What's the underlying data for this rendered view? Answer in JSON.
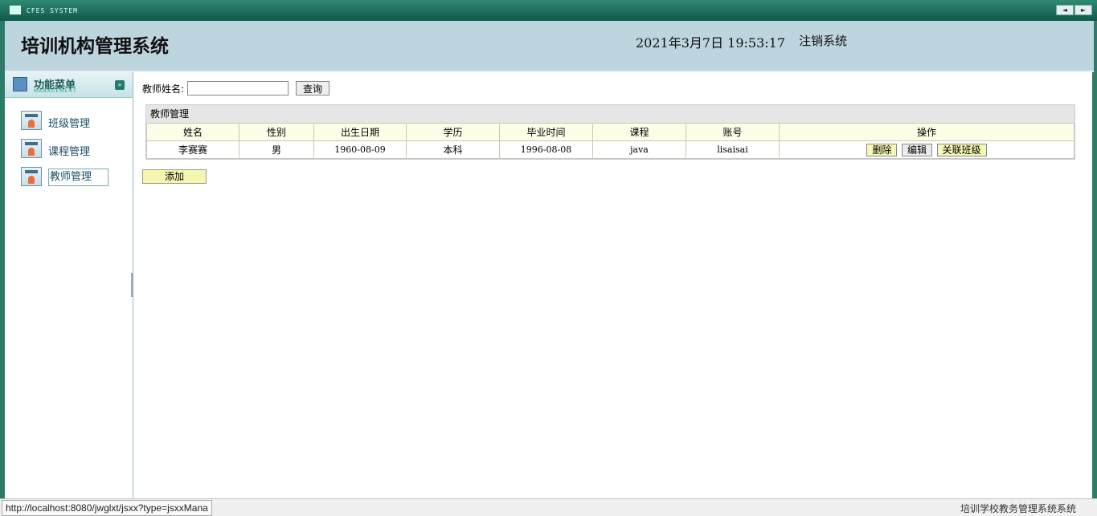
{
  "window": {
    "system_name": "CFES SYSTEM",
    "nav_prev": "◄",
    "nav_next": "►"
  },
  "header": {
    "title": "培训机构管理系统",
    "datetime": "2021年3月7日 19:53:17",
    "logout_label": "注销系统"
  },
  "sidebar": {
    "menu_title": "功能菜单",
    "menu_subtitle": "MANAGEMENT",
    "toggle_icon": "chevron-double-down-icon",
    "items": [
      {
        "label": "班级管理",
        "icon": "class-management-icon"
      },
      {
        "label": "课程管理",
        "icon": "course-management-icon"
      },
      {
        "label": "教师管理",
        "icon": "teacher-management-icon",
        "active": true
      }
    ]
  },
  "search": {
    "label": "教师姓名:",
    "value": "",
    "placeholder": "",
    "button_label": "查询"
  },
  "table": {
    "caption": "教师管理",
    "columns": [
      "姓名",
      "性别",
      "出生日期",
      "学历",
      "毕业时间",
      "课程",
      "账号",
      "操作"
    ],
    "rows": [
      {
        "name": "李赛赛",
        "gender": "男",
        "birth_date": "1960-08-09",
        "education": "本科",
        "graduation_date": "1996-08-08",
        "course": "java",
        "account": "lisaisai",
        "actions": {
          "delete": "删除",
          "edit": "编辑",
          "link_class": "关联班级"
        }
      }
    ]
  },
  "add_button_label": "添加",
  "statusbar": {
    "url": "http://localhost:8080/jwglxt/jsxx?type=jsxxMana",
    "footer_text": "培训学校教务管理系统系统"
  },
  "colors": {
    "frame_green": "#2d7c6a",
    "header_bg": "#bcd5df",
    "header_row_bg": "#fdfde8",
    "yellow_button": "#f7f7b6"
  }
}
